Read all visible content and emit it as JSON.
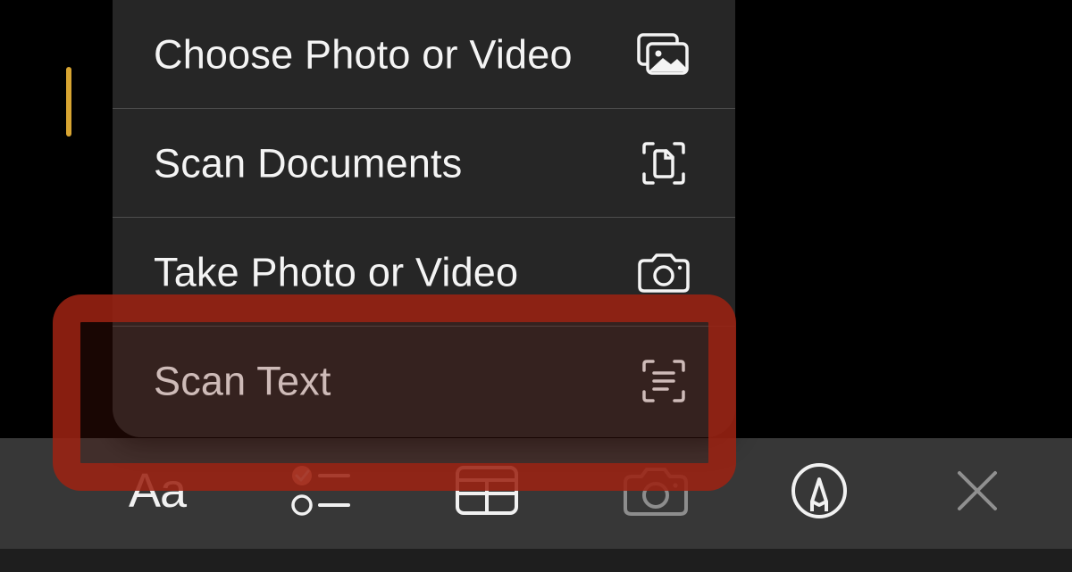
{
  "menu": {
    "items": [
      {
        "label": "Choose Photo or Video",
        "icon": "photo-library-icon"
      },
      {
        "label": "Scan Documents",
        "icon": "document-scan-icon"
      },
      {
        "label": "Take Photo or Video",
        "icon": "camera-icon"
      },
      {
        "label": "Scan Text",
        "icon": "text-scan-icon"
      }
    ]
  },
  "toolbar": {
    "format_label": "Aa",
    "tools": [
      {
        "name": "format-text",
        "icon": "text-format-icon"
      },
      {
        "name": "checklist",
        "icon": "checklist-icon"
      },
      {
        "name": "table",
        "icon": "table-icon"
      },
      {
        "name": "camera",
        "icon": "camera-icon"
      },
      {
        "name": "markup",
        "icon": "markup-pen-icon"
      },
      {
        "name": "close",
        "icon": "close-icon"
      }
    ]
  },
  "colors": {
    "background": "#000000",
    "menu_background": "#262626",
    "toolbar_background": "#373737",
    "text_cursor": "#d8a532",
    "highlight": "#9f2313"
  }
}
